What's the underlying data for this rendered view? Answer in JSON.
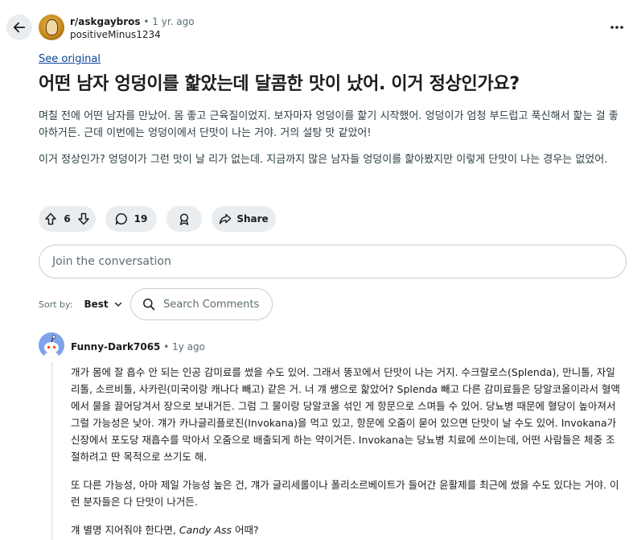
{
  "header": {
    "subreddit": "r/askgaybros",
    "separator": "•",
    "post_age": "1 yr. ago",
    "author": "positiveMinus1234"
  },
  "post": {
    "see_original": "See original",
    "title": "어떤 남자 엉덩이를 핥았는데 달콤한 맛이 났어. 이거 정상인가요?",
    "paragraphs": [
      "며칠 전에 어떤 남자를 만났어. 몸 좋고 근육질이었지. 보자마자 엉덩이를 핥기 시작했어. 엉덩이가 엄청 부드럽고 푹신해서 핥는 걸 좋아하거든. 근데 이번에는 엉덩이에서 단맛이 나는 거야. 거의 설탕 맛 같았어!",
      "이거 정상인가? 엉덩이가 그런 맛이 날 리가 없는데. 지금까지 많은 남자들 엉덩이를 핥아봤지만 이렇게 단맛이 나는 경우는 없었어."
    ]
  },
  "actions": {
    "score": "6",
    "comments": "19",
    "share": "Share"
  },
  "join": {
    "placeholder": "Join the conversation"
  },
  "sort": {
    "label": "Sort by:",
    "value": "Best",
    "search_placeholder": "Search Comments"
  },
  "comment": {
    "author": "Funny-Dark7065",
    "separator": "•",
    "age": "1y ago",
    "paragraphs": [
      "개가 몸에 잘 흡수 안 되는 인공 감미료를 썼을 수도 있어. 그래서 똥꼬에서 단맛이 나는 거지. 수크랄로스(Splenda), 만니톨, 자일리톨, 소르비톨, 사카린(미국이랑 캐나다 빼고) 같은 거. 너 걔 쌩으로 핥았어? Splenda 빼고 다른 감미료들은 당알코올이라서 혈액에서 물을 끌어당겨서 장으로 보내거든. 그럼 그 물이랑 당알코올 섞인 게 항문으로 스며들 수 있어. 당뇨병 때문에 혈당이 높아져서 그럴 가능성은 낮아. 걔가 카나글리플로진(Invokana)을 먹고 있고, 항문에 오줌이 묻어 있으면 단맛이 날 수도 있어. Invokana가 신장에서 포도당 재흡수를 막아서 오줌으로 배출되게 하는 약이거든. Invokana는 당뇨병 치료에 쓰이는데, 어떤 사람들은 체중 조절하려고 딴 목적으로 쓰기도 해.",
      "또 다른 가능성, 아마 제일 가능성 높은 건, 걔가 글리세롤이나 폴리소르베이트가 들어간 윤활제를 최근에 썼을 수도 있다는 거야. 이런 분자들은 다 단맛이 나거든."
    ],
    "last_line_prefix": "걔 별명 지어줘야 한다면, ",
    "last_line_emph": "Candy Ass",
    "last_line_suffix": " 어때?"
  }
}
